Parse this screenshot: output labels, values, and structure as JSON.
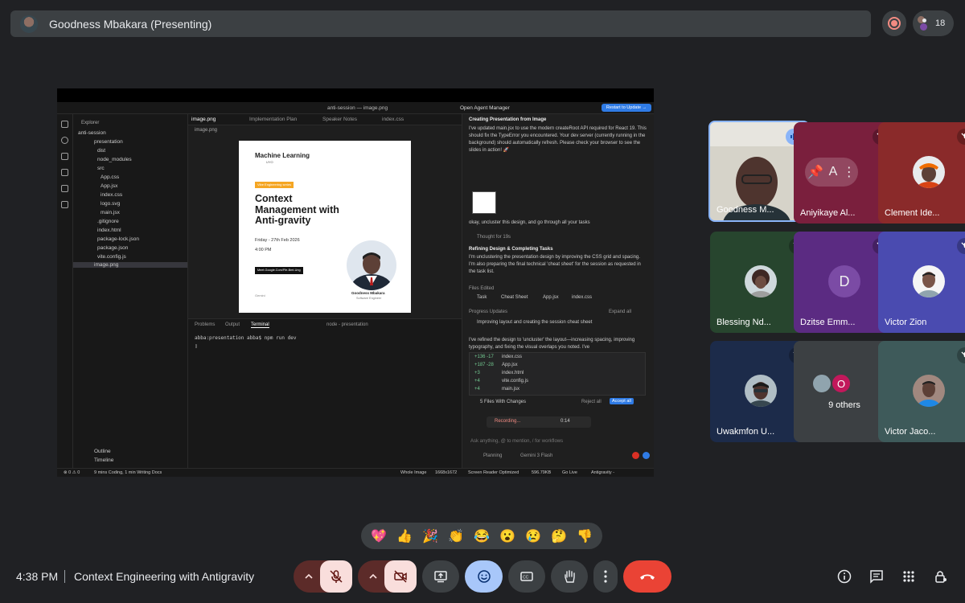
{
  "presenter": {
    "name": "Goodness Mbakara (Presenting)",
    "participant_count": "18"
  },
  "screen": {
    "title": "anti-session — image.png",
    "open_agent_manager": "Open Agent Manager",
    "restart_label": "Restart to Update →",
    "explorer": {
      "header": "Explorer",
      "items": [
        "anti-session",
        "presentation",
        "dist",
        "node_modules",
        "src",
        "App.css",
        "App.jsx",
        "index.css",
        "logo.svg",
        "main.jsx",
        ".gitignore",
        "index.html",
        "package-lock.json",
        "package.json",
        "vite.config.js",
        "image.png"
      ],
      "outline": "Outline",
      "timeline": "Timeline"
    },
    "tabs": [
      "image.png",
      "Implementation Plan",
      "Speaker Notes",
      "index.css"
    ],
    "breadcrumb": "image.png",
    "slide": {
      "logo": "Machine Learning",
      "logo_sub": "UYO",
      "series_tag": "Vibe Engineering series",
      "title_line1": "Context",
      "title_line2": "Management with",
      "title_line3": "Anti-gravity",
      "date": "Friday - 27th Feb 2026",
      "time": "4:00 PM",
      "link": "Meet.Google.Com/Ffe-Bmt-Ung",
      "speaker_name": "Goodness Mbakara",
      "speaker_role": "Software Engineer",
      "logos": "Gemini"
    },
    "panel": {
      "tabs": [
        "Problems",
        "Output",
        "Terminal"
      ],
      "terminal_label": "node - presentation",
      "terminal_line": "abba:presentation abba$ npm run dev"
    },
    "agent": {
      "header": "Creating Presentation from Image",
      "p1": "I've updated main.jsx to use the modern createRoot API required for React 19. This should fix the TypeError you encountered. Your dev server (currently running in the background) should automatically refresh. Please check your browser to see the slides in action! 🚀",
      "user_msg": "okay, uncluster this design, and go through all your tasks",
      "thought": "Thought for 19s",
      "refining_title": "Refining Design & Completing Tasks",
      "refining_text": "I'm unclustering the presentation design by improving the CSS grid and spacing. I'm also preparing the final technical 'cheat sheet' for the session as requested in the task list.",
      "files_edited": "Files Edited",
      "files": [
        "Task",
        "Cheat Sheet",
        "App.jsx",
        "index.css"
      ],
      "progress_updates": "Progress Updates",
      "expand_all": "Expand all",
      "progress_item": "Improving layout and creating the session cheat sheet",
      "p2": "I've refined the design to 'uncluster' the layout—increasing spacing, improving typography, and fixing the visual overlaps you noted. I've",
      "changed_files": [
        {
          "diff": "+136 -17",
          "name": "index.css"
        },
        {
          "diff": "+187 -28",
          "name": "App.jsx"
        },
        {
          "diff": "+3",
          "name": "index.html"
        },
        {
          "diff": "+4",
          "name": "vite.config.js"
        },
        {
          "diff": "+4",
          "name": "main.jsx"
        }
      ],
      "files_changes": "5 Files With Changes",
      "reject_all": "Reject all",
      "accept_all": "Accept all",
      "recording": "Recording...",
      "recording_time": "0:14",
      "input_placeholder": "Ask anything, @ to mention, / for workflows",
      "planning": "Planning",
      "model": "Gemini 3 Flash"
    },
    "status": {
      "left": "9 mins Coding, 1 min Writing Docs",
      "errors": "0",
      "warnings": "0",
      "whole_image": "Whole Image",
      "dims": "1668x1672",
      "screen_reader": "Screen Reader Optimized",
      "size": "596.79KB",
      "go_live": "Go Live",
      "antigravity": "Antigravity -"
    }
  },
  "participants": [
    {
      "name": "Goodness M...",
      "speaking": true
    },
    {
      "name": "Aniyikaye Al...",
      "muted": true
    },
    {
      "name": "Clement Ide...",
      "muted": true
    },
    {
      "name": "Blessing Nd...",
      "muted": true
    },
    {
      "name": "Dzitse Emm...",
      "initial": "D",
      "muted": true
    },
    {
      "name": "Victor Zion",
      "muted": true
    },
    {
      "name": "Uwakmfon U...",
      "muted": true
    },
    {
      "name": "9 others",
      "initial": "O"
    },
    {
      "name": "Victor Jaco...",
      "muted": true
    }
  ],
  "reactions": [
    "💖",
    "👍",
    "🎉",
    "👏",
    "😂",
    "😮",
    "😢",
    "🤔",
    "👎"
  ],
  "meeting": {
    "time": "4:38 PM",
    "title": "Context Engineering with Antigravity"
  },
  "colors": {
    "background": "#202124",
    "end_call": "#ea4335",
    "mic_off_bg": "#f9dedc",
    "accent": "#8ab4f8"
  }
}
